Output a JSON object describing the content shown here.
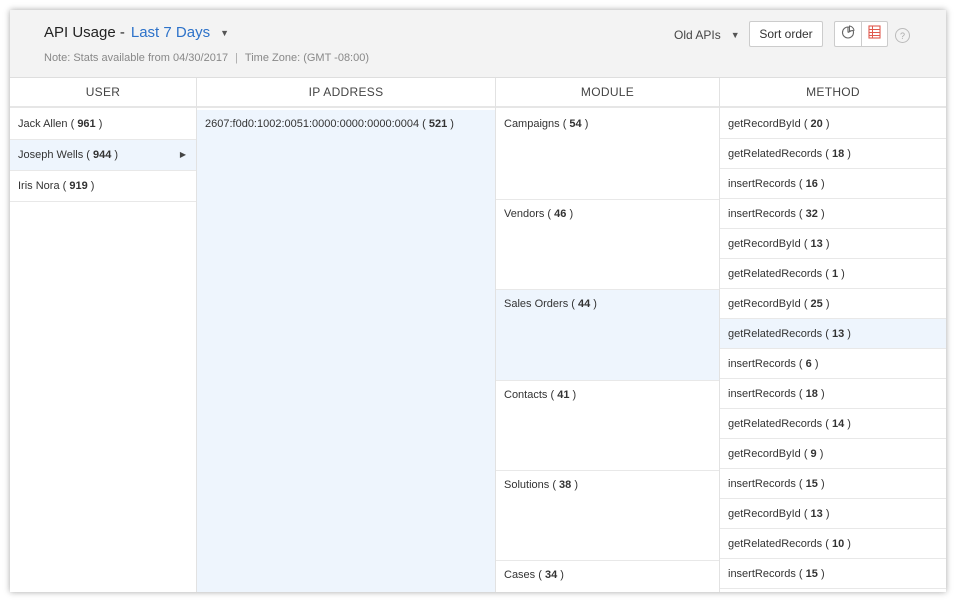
{
  "header": {
    "title": "API Usage -",
    "range_label": "Last 7 Days",
    "note_text": "Note: Stats available from 04/30/2017",
    "separator": "|",
    "timezone_text": "Time Zone: (GMT -08:00)",
    "old_apis_label": "Old APIs",
    "sort_label": "Sort order",
    "help_label": "?"
  },
  "columns": {
    "user": "USER",
    "ip": "IP ADDRESS",
    "module": "MODULE",
    "method": "METHOD"
  },
  "users": [
    {
      "name": "Jack Allen",
      "count": "961"
    },
    {
      "name": "Joseph Wells",
      "count": "944"
    },
    {
      "name": "Iris Nora",
      "count": "919"
    }
  ],
  "ips": [
    {
      "address": "2607:f0d0:1002:0051:0000:0000:0000:0004",
      "count": "521"
    }
  ],
  "modules": [
    {
      "name": "Campaigns",
      "count": "54",
      "methods": [
        {
          "name": "getRecordById",
          "count": "20"
        },
        {
          "name": "getRelatedRecords",
          "count": "18"
        },
        {
          "name": "insertRecords",
          "count": "16"
        }
      ]
    },
    {
      "name": "Vendors",
      "count": "46",
      "methods": [
        {
          "name": "insertRecords",
          "count": "32"
        },
        {
          "name": "getRecordById",
          "count": "13"
        },
        {
          "name": "getRelatedRecords",
          "count": "1"
        }
      ]
    },
    {
      "name": "Sales Orders",
      "count": "44",
      "methods": [
        {
          "name": "getRecordById",
          "count": "25"
        },
        {
          "name": "getRelatedRecords",
          "count": "13"
        },
        {
          "name": "insertRecords",
          "count": "6"
        }
      ]
    },
    {
      "name": "Contacts",
      "count": "41",
      "methods": [
        {
          "name": "insertRecords",
          "count": "18"
        },
        {
          "name": "getRelatedRecords",
          "count": "14"
        },
        {
          "name": "getRecordById",
          "count": "9"
        }
      ]
    },
    {
      "name": "Solutions",
      "count": "38",
      "methods": [
        {
          "name": "insertRecords",
          "count": "15"
        },
        {
          "name": "getRecordById",
          "count": "13"
        },
        {
          "name": "getRelatedRecords",
          "count": "10"
        }
      ]
    },
    {
      "name": "Cases",
      "count": "34",
      "methods": [
        {
          "name": "insertRecords",
          "count": "15"
        }
      ]
    }
  ],
  "colors": {
    "accent": "#2d72c9",
    "selected_bg": "#eef5fd",
    "header_bg": "#f3f3f3"
  },
  "icons": [
    "chart-view-icon",
    "table-view-icon",
    "help-icon",
    "chevron-down-icon",
    "chevron-right-icon"
  ]
}
